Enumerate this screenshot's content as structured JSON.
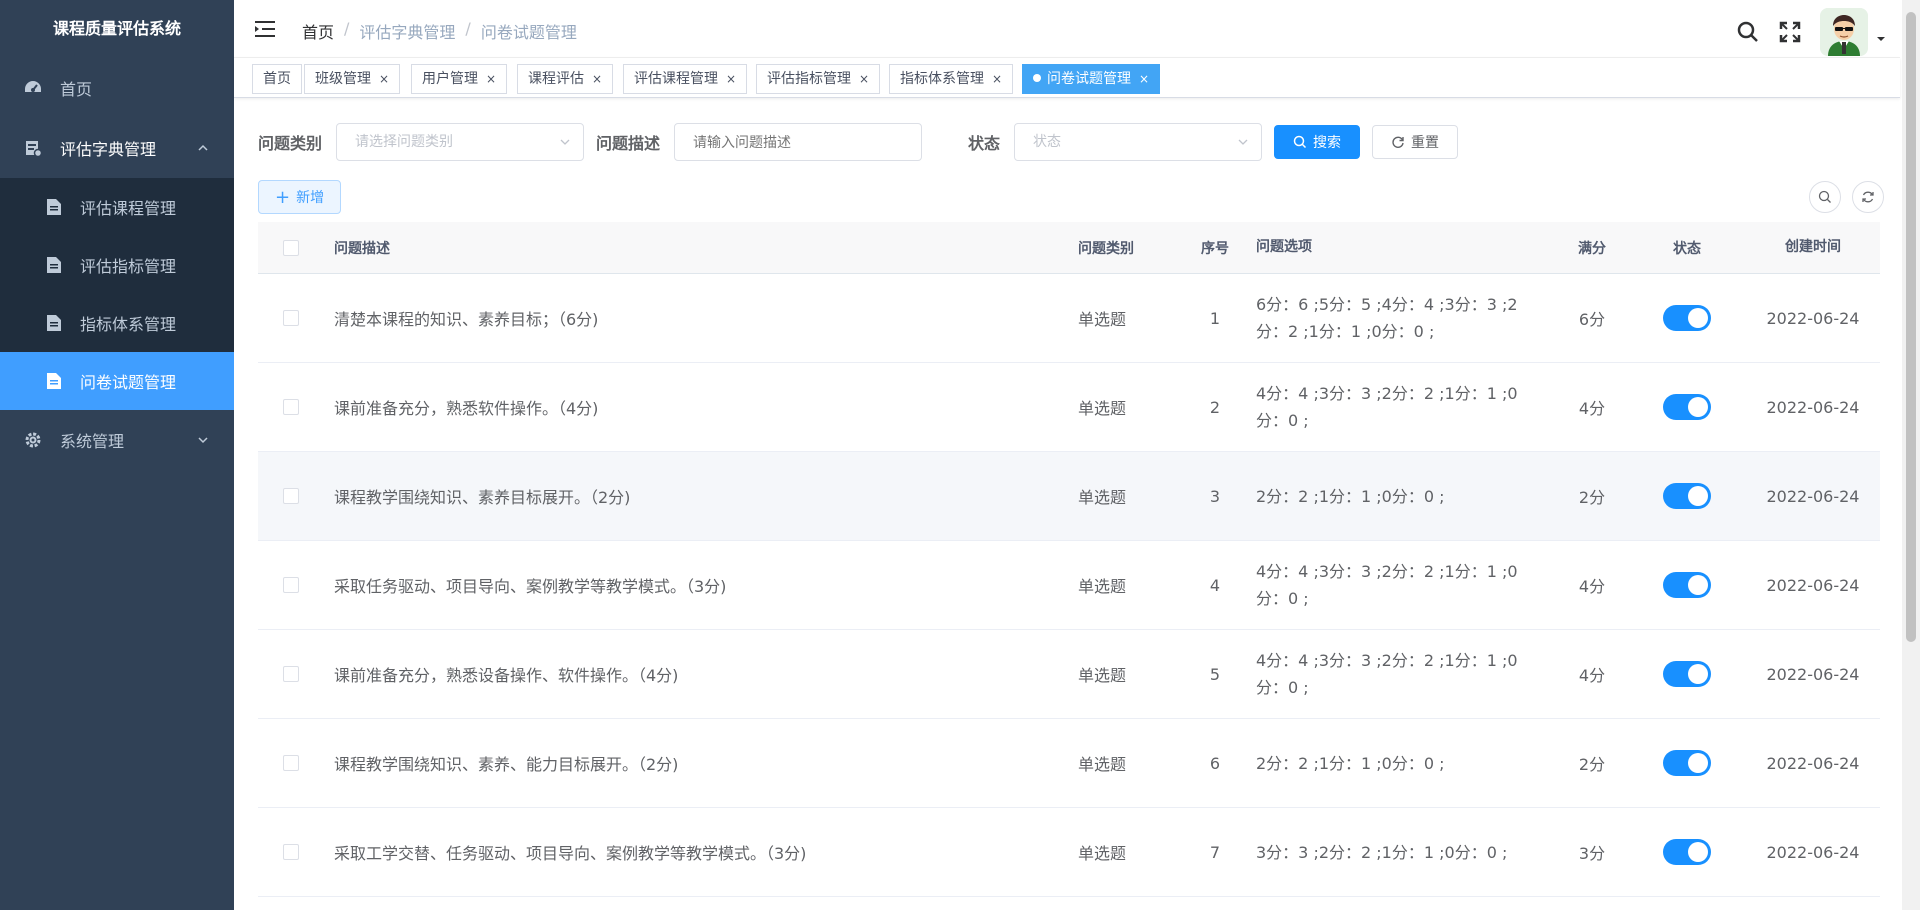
{
  "app": {
    "title": "课程质量评估系统"
  },
  "sidebar": {
    "items": [
      {
        "label": "首页",
        "icon": "dashboard-icon"
      },
      {
        "label": "评估字典管理",
        "icon": "dictionary-icon",
        "open": true,
        "children": [
          {
            "label": "评估课程管理",
            "icon": "document-icon"
          },
          {
            "label": "评估指标管理",
            "icon": "document-icon"
          },
          {
            "label": "指标体系管理",
            "icon": "document-icon"
          },
          {
            "label": "问卷试题管理",
            "icon": "document-icon",
            "active": true
          }
        ]
      },
      {
        "label": "系统管理",
        "icon": "gear-icon"
      }
    ]
  },
  "breadcrumb": [
    "首页",
    "评估字典管理",
    "问卷试题管理"
  ],
  "tags": [
    {
      "label": "首页",
      "closable": false
    },
    {
      "label": "班级管理",
      "closable": true
    },
    {
      "label": "用户管理",
      "closable": true
    },
    {
      "label": "课程评估",
      "closable": true
    },
    {
      "label": "评估课程管理",
      "closable": true
    },
    {
      "label": "评估指标管理",
      "closable": true
    },
    {
      "label": "指标体系管理",
      "closable": true
    },
    {
      "label": "问卷试题管理",
      "closable": true,
      "active": true
    }
  ],
  "tag_close": "×",
  "search": {
    "category_label": "问题类别",
    "category_placeholder": "请选择问题类别",
    "desc_label": "问题描述",
    "desc_placeholder": "请输入问题描述",
    "status_label": "状态",
    "status_placeholder": "状态",
    "search_button": "搜索",
    "reset_button": "重置"
  },
  "toolbar": {
    "add_button": "新增",
    "add_symbol": "+"
  },
  "table": {
    "columns": [
      "问题描述",
      "问题类别",
      "序号",
      "问题选项",
      "满分",
      "状态",
      "创建时间"
    ],
    "rows": [
      {
        "desc": "清楚本课程的知识、素养目标；（6分)",
        "type": "单选题",
        "seq": "1",
        "opts": "6分：6 ;5分：5 ;4分：4 ;3分：3 ;2分：2 ;1分：1 ;0分：0 ;",
        "full": "6分",
        "status": true,
        "time": "2022-06-24"
      },
      {
        "desc": "课前准备充分，熟悉软件操作。（4分)",
        "type": "单选题",
        "seq": "2",
        "opts": "4分：4 ;3分：3 ;2分：2 ;1分：1 ;0分：0 ;",
        "full": "4分",
        "status": true,
        "time": "2022-06-24"
      },
      {
        "desc": "课程教学围绕知识、素养目标展开。（2分)",
        "type": "单选题",
        "seq": "3",
        "opts": "2分：2 ;1分：1 ;0分：0 ;",
        "full": "2分",
        "status": true,
        "time": "2022-06-24"
      },
      {
        "desc": "采取任务驱动、项目导向、案例教学等教学模式。（3分)",
        "type": "单选题",
        "seq": "4",
        "opts": "4分：4 ;3分：3 ;2分：2 ;1分：1 ;0分：0 ;",
        "full": "4分",
        "status": true,
        "time": "2022-06-24"
      },
      {
        "desc": "课前准备充分，熟悉设备操作、软件操作。（4分)",
        "type": "单选题",
        "seq": "5",
        "opts": "4分：4 ;3分：3 ;2分：2 ;1分：1 ;0分：0 ;",
        "full": "4分",
        "status": true,
        "time": "2022-06-24"
      },
      {
        "desc": "课程教学围绕知识、素养、能力目标展开。（2分)",
        "type": "单选题",
        "seq": "6",
        "opts": "2分：2 ;1分：1 ;0分：0 ;",
        "full": "2分",
        "status": true,
        "time": "2022-06-24"
      },
      {
        "desc": "采取工学交替、任务驱动、项目导向、案例教学等教学模式。（3分)",
        "type": "单选题",
        "seq": "7",
        "opts": "3分：3 ;2分：2 ;1分：1 ;0分：0 ;",
        "full": "3分",
        "status": true,
        "time": "2022-06-24"
      }
    ]
  },
  "colors": {
    "sidebar": "#304156",
    "submenu": "#1f2d3d",
    "active": "#409eff",
    "primary": "#1890ff"
  }
}
